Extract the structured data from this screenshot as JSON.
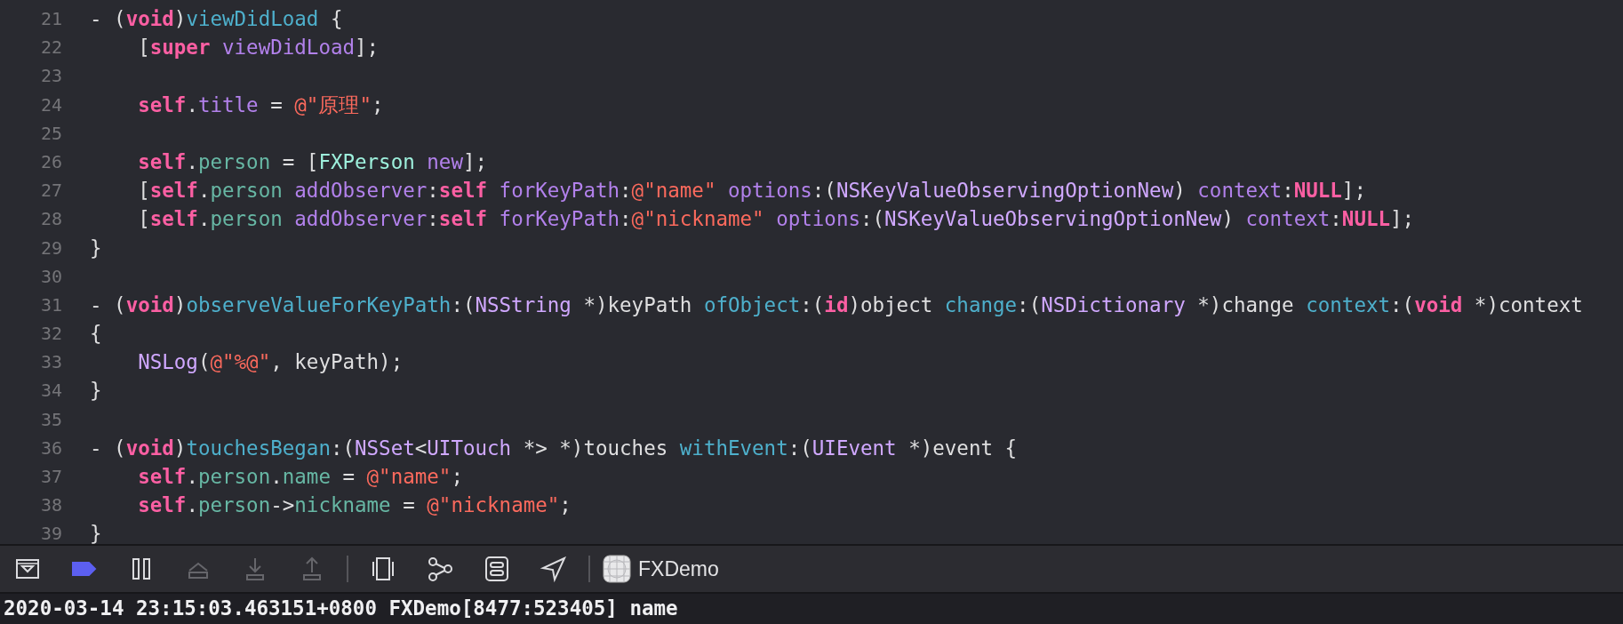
{
  "editor": {
    "lines": [
      {
        "number": "21",
        "tokens": [
          {
            "kind": "plain",
            "text": "- ("
          },
          {
            "kind": "keyword",
            "text": "void"
          },
          {
            "kind": "plain",
            "text": ")"
          },
          {
            "kind": "decl",
            "text": "viewDidLoad"
          },
          {
            "kind": "plain",
            "text": " {"
          }
        ]
      },
      {
        "number": "22",
        "tokens": [
          {
            "kind": "plain",
            "text": "    ["
          },
          {
            "kind": "keyword",
            "text": "super"
          },
          {
            "kind": "method",
            "text": " viewDidLoad"
          },
          {
            "kind": "plain",
            "text": "];"
          }
        ]
      },
      {
        "number": "23"
      },
      {
        "number": "24",
        "tokens": [
          {
            "kind": "keyword",
            "text": "    self"
          },
          {
            "kind": "plain",
            "text": "."
          },
          {
            "kind": "method",
            "text": "title"
          },
          {
            "kind": "plain",
            "text": " = "
          },
          {
            "kind": "string",
            "text": "@\"原理\""
          },
          {
            "kind": "plain",
            "text": ";"
          }
        ]
      },
      {
        "number": "25"
      },
      {
        "number": "26",
        "tokens": [
          {
            "kind": "keyword",
            "text": "    self"
          },
          {
            "kind": "plain",
            "text": "."
          },
          {
            "kind": "property",
            "text": "person"
          },
          {
            "kind": "plain",
            "text": " = ["
          },
          {
            "kind": "project",
            "text": "FXPerson"
          },
          {
            "kind": "method",
            "text": " new"
          },
          {
            "kind": "plain",
            "text": "];"
          }
        ]
      },
      {
        "number": "27",
        "tokens": [
          {
            "kind": "plain",
            "text": "    ["
          },
          {
            "kind": "keyword",
            "text": "self"
          },
          {
            "kind": "plain",
            "text": "."
          },
          {
            "kind": "property",
            "text": "person"
          },
          {
            "kind": "method",
            "text": " addObserver"
          },
          {
            "kind": "plain",
            "text": ":"
          },
          {
            "kind": "keyword",
            "text": "self"
          },
          {
            "kind": "method",
            "text": " forKeyPath"
          },
          {
            "kind": "plain",
            "text": ":"
          },
          {
            "kind": "string",
            "text": "@\"name\""
          },
          {
            "kind": "method",
            "text": " options"
          },
          {
            "kind": "plain",
            "text": ":("
          },
          {
            "kind": "type",
            "text": "NSKeyValueObservingOptionNew"
          },
          {
            "kind": "plain",
            "text": ") "
          },
          {
            "kind": "method",
            "text": "context"
          },
          {
            "kind": "plain",
            "text": ":"
          },
          {
            "kind": "keyword",
            "text": "NULL"
          },
          {
            "kind": "plain",
            "text": "];"
          }
        ]
      },
      {
        "number": "28",
        "tokens": [
          {
            "kind": "plain",
            "text": "    ["
          },
          {
            "kind": "keyword",
            "text": "self"
          },
          {
            "kind": "plain",
            "text": "."
          },
          {
            "kind": "property",
            "text": "person"
          },
          {
            "kind": "method",
            "text": " addObserver"
          },
          {
            "kind": "plain",
            "text": ":"
          },
          {
            "kind": "keyword",
            "text": "self"
          },
          {
            "kind": "method",
            "text": " forKeyPath"
          },
          {
            "kind": "plain",
            "text": ":"
          },
          {
            "kind": "string",
            "text": "@\"nickname\""
          },
          {
            "kind": "method",
            "text": " options"
          },
          {
            "kind": "plain",
            "text": ":("
          },
          {
            "kind": "type",
            "text": "NSKeyValueObservingOptionNew"
          },
          {
            "kind": "plain",
            "text": ") "
          },
          {
            "kind": "method",
            "text": "context"
          },
          {
            "kind": "plain",
            "text": ":"
          },
          {
            "kind": "keyword",
            "text": "NULL"
          },
          {
            "kind": "plain",
            "text": "];"
          }
        ]
      },
      {
        "number": "29",
        "tokens": [
          {
            "kind": "plain",
            "text": "}"
          }
        ]
      },
      {
        "number": "30"
      },
      {
        "number": "31",
        "tokens": [
          {
            "kind": "plain",
            "text": "- ("
          },
          {
            "kind": "keyword",
            "text": "void"
          },
          {
            "kind": "plain",
            "text": ")"
          },
          {
            "kind": "decl",
            "text": "observeValueForKeyPath"
          },
          {
            "kind": "plain",
            "text": ":("
          },
          {
            "kind": "type",
            "text": "NSString"
          },
          {
            "kind": "plain",
            "text": " *)keyPath "
          },
          {
            "kind": "decl",
            "text": "ofObject"
          },
          {
            "kind": "plain",
            "text": ":("
          },
          {
            "kind": "keyword",
            "text": "id"
          },
          {
            "kind": "plain",
            "text": ")object "
          },
          {
            "kind": "decl",
            "text": "change"
          },
          {
            "kind": "plain",
            "text": ":("
          },
          {
            "kind": "type",
            "text": "NSDictionary"
          },
          {
            "kind": "plain",
            "text": " *)change "
          },
          {
            "kind": "decl",
            "text": "context"
          },
          {
            "kind": "plain",
            "text": ":("
          },
          {
            "kind": "keyword",
            "text": "void"
          },
          {
            "kind": "plain",
            "text": " *)context"
          }
        ]
      },
      {
        "number": "32",
        "tokens": [
          {
            "kind": "plain",
            "text": "{"
          }
        ]
      },
      {
        "number": "33",
        "tokens": [
          {
            "kind": "type",
            "text": "    NSLog"
          },
          {
            "kind": "plain",
            "text": "("
          },
          {
            "kind": "string",
            "text": "@\"%@\""
          },
          {
            "kind": "plain",
            "text": ", keyPath);"
          }
        ]
      },
      {
        "number": "34",
        "tokens": [
          {
            "kind": "plain",
            "text": "}"
          }
        ]
      },
      {
        "number": "35"
      },
      {
        "number": "36",
        "tokens": [
          {
            "kind": "plain",
            "text": "- ("
          },
          {
            "kind": "keyword",
            "text": "void"
          },
          {
            "kind": "plain",
            "text": ")"
          },
          {
            "kind": "decl",
            "text": "touchesBegan"
          },
          {
            "kind": "plain",
            "text": ":("
          },
          {
            "kind": "type",
            "text": "NSSet"
          },
          {
            "kind": "plain",
            "text": "<"
          },
          {
            "kind": "type",
            "text": "UITouch"
          },
          {
            "kind": "plain",
            "text": " *> *)touches "
          },
          {
            "kind": "decl",
            "text": "withEvent"
          },
          {
            "kind": "plain",
            "text": ":("
          },
          {
            "kind": "type",
            "text": "UIEvent"
          },
          {
            "kind": "plain",
            "text": " *)event {"
          }
        ]
      },
      {
        "number": "37",
        "tokens": [
          {
            "kind": "keyword",
            "text": "    self"
          },
          {
            "kind": "plain",
            "text": "."
          },
          {
            "kind": "property",
            "text": "person"
          },
          {
            "kind": "plain",
            "text": "."
          },
          {
            "kind": "property",
            "text": "name"
          },
          {
            "kind": "plain",
            "text": " = "
          },
          {
            "kind": "string",
            "text": "@\"name\""
          },
          {
            "kind": "plain",
            "text": ";"
          }
        ]
      },
      {
        "number": "38",
        "tokens": [
          {
            "kind": "keyword",
            "text": "    self"
          },
          {
            "kind": "plain",
            "text": "."
          },
          {
            "kind": "property",
            "text": "person"
          },
          {
            "kind": "plain",
            "text": "->"
          },
          {
            "kind": "property",
            "text": "nickname"
          },
          {
            "kind": "plain",
            "text": " = "
          },
          {
            "kind": "string",
            "text": "@\"nickname\""
          },
          {
            "kind": "plain",
            "text": ";"
          }
        ]
      },
      {
        "number": "39",
        "tokens": [
          {
            "kind": "plain",
            "text": "}"
          }
        ]
      }
    ]
  },
  "debug_bar": {
    "buttons": [
      {
        "kind": "hide",
        "disabled": false
      },
      {
        "kind": "breakpoints",
        "active": true,
        "disabled": false
      },
      {
        "kind": "pause",
        "disabled": false
      },
      {
        "kind": "step-over",
        "disabled": true
      },
      {
        "kind": "step-in",
        "disabled": true
      },
      {
        "kind": "step-out",
        "disabled": true
      },
      {
        "kind": "divider"
      },
      {
        "kind": "view-debug",
        "disabled": false
      },
      {
        "kind": "memory",
        "disabled": false
      },
      {
        "kind": "environment",
        "disabled": false
      },
      {
        "kind": "location",
        "disabled": false
      },
      {
        "kind": "divider"
      }
    ],
    "target": "FXDemo"
  },
  "console": {
    "lines": [
      "2020-03-14 23:15:03.463151+0800 FXDemo[8477:523405] name"
    ]
  }
}
